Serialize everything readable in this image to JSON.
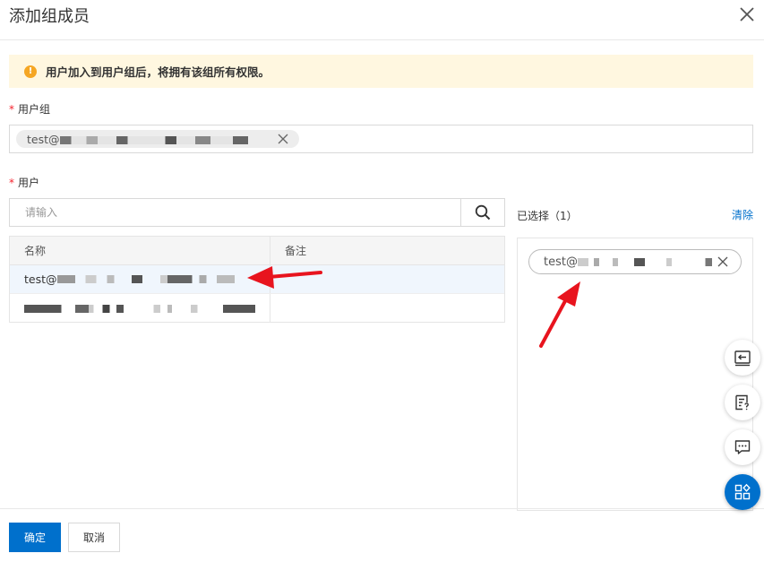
{
  "dialog": {
    "title": "添加组成员"
  },
  "alert": {
    "icon": "warning-icon",
    "text": "用户加入到用户组后，将拥有该组所有权限。",
    "color": "#fff7e0"
  },
  "group_field": {
    "required_mark": "*",
    "label": "用户组",
    "tag_text": "test@"
  },
  "user_field": {
    "required_mark": "*",
    "label": "用户",
    "search_placeholder": "请输入",
    "search_icon": "search-icon"
  },
  "table": {
    "columns": [
      "名称",
      "备注"
    ],
    "rows": [
      {
        "name": "test@",
        "note": "",
        "selected": true
      },
      {
        "name": "",
        "note": "",
        "selected": false
      }
    ]
  },
  "selected_panel": {
    "title": "已选择（1）",
    "clear_label": "清除",
    "items": [
      {
        "label": "test@"
      }
    ]
  },
  "footer": {
    "confirm_label": "确定",
    "cancel_label": "取消"
  },
  "floating_toolbar": {
    "icons": [
      "collapse-panel-icon",
      "feedback-icon",
      "chat-icon",
      "apps-icon"
    ]
  },
  "colors": {
    "primary": "#0070cc",
    "required": "#f5222d",
    "warning": "#f5a623",
    "annotation_arrow": "#e8141e"
  }
}
